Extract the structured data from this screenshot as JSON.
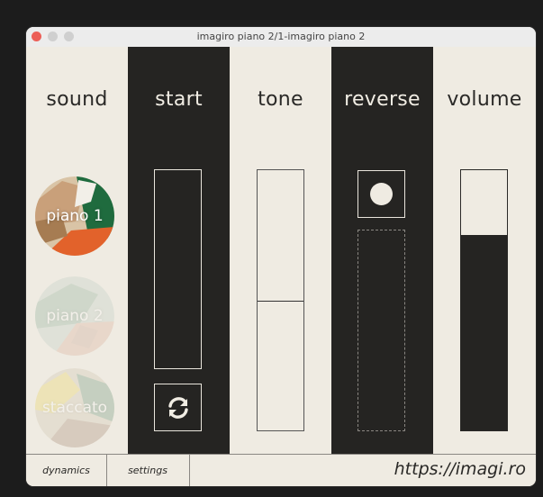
{
  "window": {
    "title": "imagiro piano 2/1-imagiro piano 2"
  },
  "columns": {
    "sound": "sound",
    "start": "start",
    "tone": "tone",
    "reverse": "reverse",
    "volume": "volume"
  },
  "sounds": [
    {
      "label": "piano 1",
      "selected": true
    },
    {
      "label": "piano 2",
      "selected": false
    },
    {
      "label": "staccato",
      "selected": false
    }
  ],
  "controls": {
    "start_position": 0.0,
    "tone_level": 0.5,
    "reverse_enabled": true,
    "volume_level": 0.75
  },
  "icons": {
    "reload": "reload-icon",
    "reverse": "circle-icon"
  },
  "footer": {
    "dynamics": "dynamics",
    "settings": "settings",
    "link": "https://imagi.ro"
  },
  "colors": {
    "light_panel": "#efebe2",
    "dark_panel": "#252422",
    "green_accent": "#1f6b3e",
    "orange_accent": "#e2622b",
    "tan_accent": "#c9a07a"
  }
}
